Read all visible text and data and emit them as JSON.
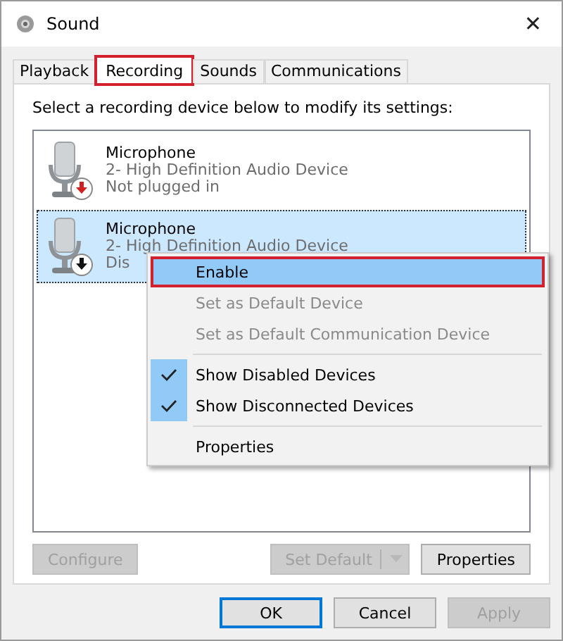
{
  "window": {
    "title": "Sound",
    "close": "✕"
  },
  "tabs": [
    {
      "label": "Playback",
      "selected": false,
      "highlighted": false
    },
    {
      "label": "Recording",
      "selected": true,
      "highlighted": true
    },
    {
      "label": "Sounds",
      "selected": false,
      "highlighted": false
    },
    {
      "label": "Communications",
      "selected": false,
      "highlighted": false
    }
  ],
  "instruction": "Select a recording device below to modify its settings:",
  "devices": [
    {
      "name": "Microphone",
      "description": "2- High Definition Audio Device",
      "status": "Not plugged in",
      "color": "#d21f1f",
      "selected": false
    },
    {
      "name": "Microphone",
      "description": "2- High Definition Audio Device",
      "status": "Dis",
      "color": "#111111",
      "selected": true
    }
  ],
  "context_menu": {
    "items": [
      {
        "kind": "item",
        "label": "Enable",
        "selected": true,
        "disabled": false,
        "checked": false,
        "highlighted": true
      },
      {
        "kind": "item",
        "label": "Set as Default Device",
        "selected": false,
        "disabled": true,
        "checked": false,
        "highlighted": false
      },
      {
        "kind": "item",
        "label": "Set as Default Communication Device",
        "selected": false,
        "disabled": true,
        "checked": false,
        "highlighted": false
      },
      {
        "kind": "separator"
      },
      {
        "kind": "item",
        "label": "Show Disabled Devices",
        "selected": false,
        "disabled": false,
        "checked": true,
        "highlighted": false
      },
      {
        "kind": "item",
        "label": "Show Disconnected Devices",
        "selected": false,
        "disabled": false,
        "checked": true,
        "highlighted": false
      },
      {
        "kind": "separator"
      },
      {
        "kind": "item",
        "label": "Properties",
        "selected": false,
        "disabled": false,
        "checked": false,
        "highlighted": false
      }
    ]
  },
  "panel_buttons": [
    {
      "kind": "button",
      "label": "Configure",
      "disabled": true
    },
    {
      "kind": "split",
      "label": "Set Default",
      "disabled": true
    },
    {
      "kind": "button",
      "label": "Properties",
      "disabled": false
    }
  ],
  "dialog_buttons": [
    {
      "label": "OK",
      "disabled": false,
      "default": true
    },
    {
      "label": "Cancel",
      "disabled": false,
      "default": false
    },
    {
      "label": "Apply",
      "disabled": true,
      "default": false
    }
  ]
}
